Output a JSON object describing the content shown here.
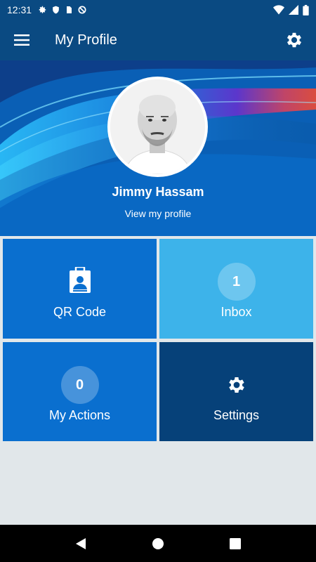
{
  "status_bar": {
    "time": "12:31"
  },
  "app_bar": {
    "title": "My Profile",
    "menu_icon": "menu-icon",
    "settings_icon": "gear-icon"
  },
  "profile": {
    "name": "Jimmy Hassam",
    "view_link": "View my profile"
  },
  "tiles": {
    "qr": {
      "label": "QR Code",
      "icon": "id-badge-icon"
    },
    "inbox": {
      "label": "Inbox",
      "count": "1"
    },
    "actions": {
      "label": "My Actions",
      "count": "0"
    },
    "settings": {
      "label": "Settings",
      "icon": "gear-icon"
    }
  },
  "colors": {
    "app_bar": "#0a4a82",
    "tile_blue": "#0a6fcf",
    "tile_light": "#3db3ea",
    "tile_dark": "#064179",
    "background": "#e1e7ea"
  }
}
